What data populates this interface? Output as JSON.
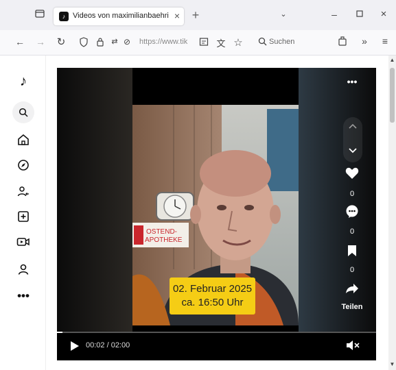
{
  "tab": {
    "title": "Videos von maximilianbaehring"
  },
  "url": {
    "text": "https://www.tik",
    "search_placeholder": "Suchen"
  },
  "video": {
    "caption_line1": "02. Februar 2025",
    "caption_line2": "ca. 16:50 Uhr",
    "time": "00:02 / 02:00",
    "progress": 0.017,
    "like_count": "0",
    "comment_count": "0",
    "save_count": "0",
    "share_label": "Teilen",
    "sign_line1": "OSTEND-",
    "sign_line2": "APOTHEKE"
  },
  "colors": {
    "caption_bg": "#f5cd15",
    "video_bg": "#000000"
  }
}
